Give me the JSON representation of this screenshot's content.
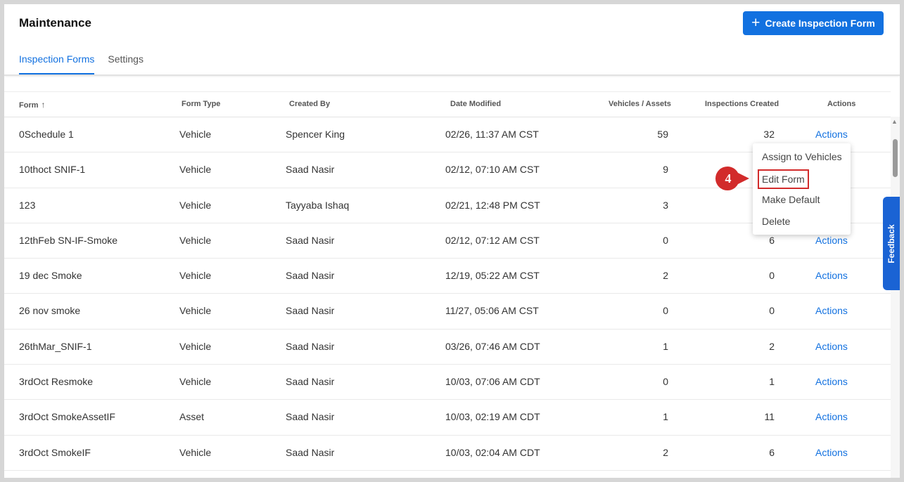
{
  "header": {
    "title": "Maintenance",
    "create_button": "Create Inspection Form",
    "create_icon": "+"
  },
  "tabs": [
    {
      "label": "Inspection Forms",
      "active": true
    },
    {
      "label": "Settings",
      "active": false
    }
  ],
  "table": {
    "columns": {
      "form": "Form",
      "sort_arrow": "↑",
      "type": "Form Type",
      "created_by": "Created By",
      "date_modified": "Date Modified",
      "vehicles": "Vehicles / Assets",
      "inspections": "Inspections Created",
      "actions": "Actions"
    },
    "rows": [
      {
        "form": "0Schedule 1",
        "type": "Vehicle",
        "by": "Spencer King",
        "date": "02/26, 11:37 AM CST",
        "vehicles": "59",
        "inspections": "32",
        "action": "Actions"
      },
      {
        "form": "10thoct SNIF-1",
        "type": "Vehicle",
        "by": "Saad Nasir",
        "date": "02/12, 07:10 AM CST",
        "vehicles": "9",
        "inspections": "",
        "action": ""
      },
      {
        "form": "123",
        "type": "Vehicle",
        "by": "Tayyaba Ishaq",
        "date": "02/21, 12:48 PM CST",
        "vehicles": "3",
        "inspections": "",
        "action": ""
      },
      {
        "form": "12thFeb SN-IF-Smoke",
        "type": "Vehicle",
        "by": "Saad Nasir",
        "date": "02/12, 07:12 AM CST",
        "vehicles": "0",
        "inspections": "6",
        "action": "Actions"
      },
      {
        "form": "19 dec Smoke",
        "type": "Vehicle",
        "by": "Saad Nasir",
        "date": "12/19, 05:22 AM CST",
        "vehicles": "2",
        "inspections": "0",
        "action": "Actions"
      },
      {
        "form": "26 nov smoke",
        "type": "Vehicle",
        "by": "Saad Nasir",
        "date": "11/27, 05:06 AM CST",
        "vehicles": "0",
        "inspections": "0",
        "action": "Actions"
      },
      {
        "form": "26thMar_SNIF-1",
        "type": "Vehicle",
        "by": "Saad Nasir",
        "date": "03/26, 07:46 AM CDT",
        "vehicles": "1",
        "inspections": "2",
        "action": "Actions"
      },
      {
        "form": "3rdOct Resmoke",
        "type": "Vehicle",
        "by": "Saad Nasir",
        "date": "10/03, 07:06 AM CDT",
        "vehicles": "0",
        "inspections": "1",
        "action": "Actions"
      },
      {
        "form": "3rdOct SmokeAssetIF",
        "type": "Asset",
        "by": "Saad Nasir",
        "date": "10/03, 02:19 AM CDT",
        "vehicles": "1",
        "inspections": "11",
        "action": "Actions"
      },
      {
        "form": "3rdOct SmokeIF",
        "type": "Vehicle",
        "by": "Saad Nasir",
        "date": "10/03, 02:04 AM CDT",
        "vehicles": "2",
        "inspections": "6",
        "action": "Actions"
      }
    ]
  },
  "actions_menu": {
    "items": [
      "Assign to Vehicles",
      "Edit Form",
      "Make Default",
      "Delete"
    ],
    "highlighted": "Edit Form"
  },
  "step_badge": "4",
  "feedback_label": "Feedback",
  "colors": {
    "accent": "#1271e0",
    "highlight": "#d22b2b",
    "feedback": "#1a63d4"
  }
}
